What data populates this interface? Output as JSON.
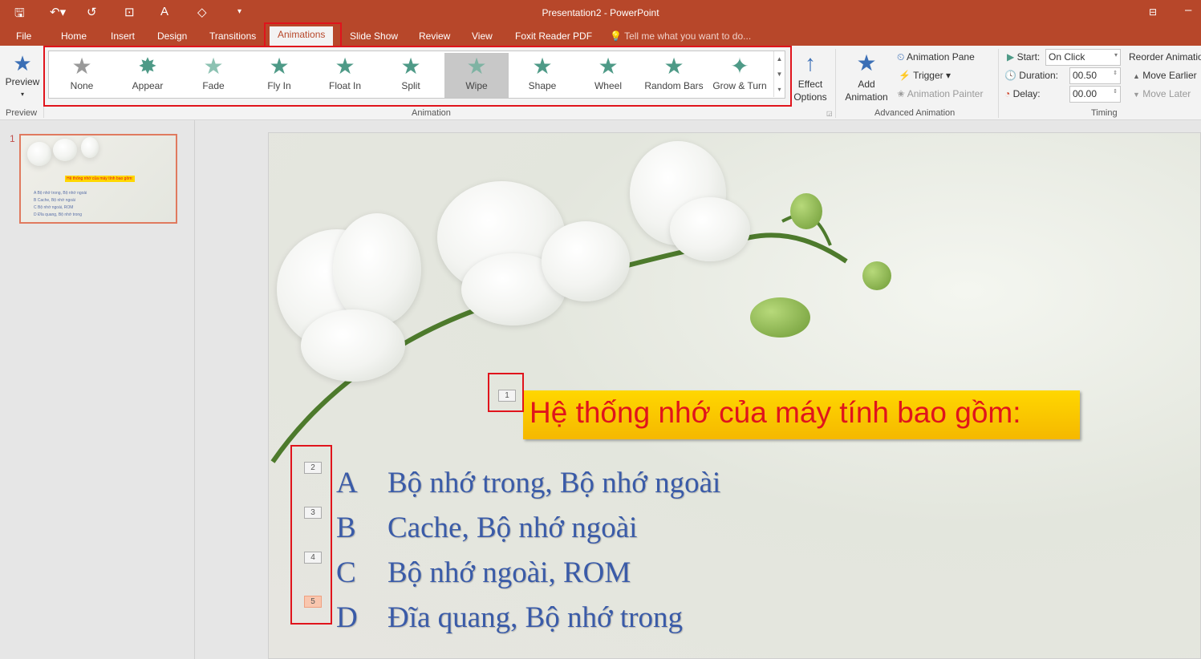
{
  "window": {
    "title": "Presentation2 - PowerPoint"
  },
  "qat": {
    "save_icon": "save-icon",
    "undo_icon": "undo-icon",
    "redo_icon": "redo-icon"
  },
  "tabs": [
    "File",
    "Home",
    "Insert",
    "Design",
    "Transitions",
    "Animations",
    "Slide Show",
    "Review",
    "View",
    "Foxit Reader PDF"
  ],
  "tell_me": "Tell me what you want to do...",
  "ribbon": {
    "preview_label": "Preview",
    "preview_group": "Preview",
    "animations": [
      "None",
      "Appear",
      "Fade",
      "Fly In",
      "Float In",
      "Split",
      "Wipe",
      "Shape",
      "Wheel",
      "Random Bars",
      "Grow & Turn"
    ],
    "selected_animation": "Wipe",
    "animation_group": "Animation",
    "effect_options": "Effect Options",
    "add_animation": "Add Animation",
    "animation_pane": "Animation Pane",
    "trigger": "Trigger",
    "animation_painter": "Animation Painter",
    "advanced_group": "Advanced Animation",
    "start_label": "Start:",
    "start_value": "On Click",
    "duration_label": "Duration:",
    "duration_value": "00.50",
    "delay_label": "Delay:",
    "delay_value": "00.00",
    "timing_group": "Timing",
    "reorder": "Reorder Animation",
    "move_earlier": "Move Earlier",
    "move_later": "Move Later"
  },
  "thumbnails": [
    {
      "number": "1",
      "title": "Hệ thống nhớ của máy tính bao gồm:",
      "lines": [
        "A  Bộ nhớ trong, Bộ nhớ ngoài",
        "B  Cache, Bộ nhớ ngoài",
        "C  Bộ nhớ ngoài, ROM",
        "D  Đĩa quang, Bộ nhớ trong"
      ]
    }
  ],
  "slide": {
    "headline": "Hệ thống nhớ của máy tính bao gồm:",
    "headline_tag": "1",
    "items": [
      {
        "tag": "2",
        "letter": "A",
        "text": "Bộ nhớ trong, Bộ nhớ ngoài"
      },
      {
        "tag": "3",
        "letter": "B",
        "text": "Cache, Bộ nhớ ngoài"
      },
      {
        "tag": "4",
        "letter": "C",
        "text": "Bộ nhớ ngoài, ROM"
      },
      {
        "tag": "5",
        "letter": "D",
        "text": "Đĩa quang, Bộ nhớ trong"
      }
    ]
  },
  "colors": {
    "accent": "#b7472a",
    "highlight_box": "#e0141c",
    "headline_bg": "#ffd700",
    "headline_text": "#e0141c",
    "item_text": "#3a5ba8"
  }
}
